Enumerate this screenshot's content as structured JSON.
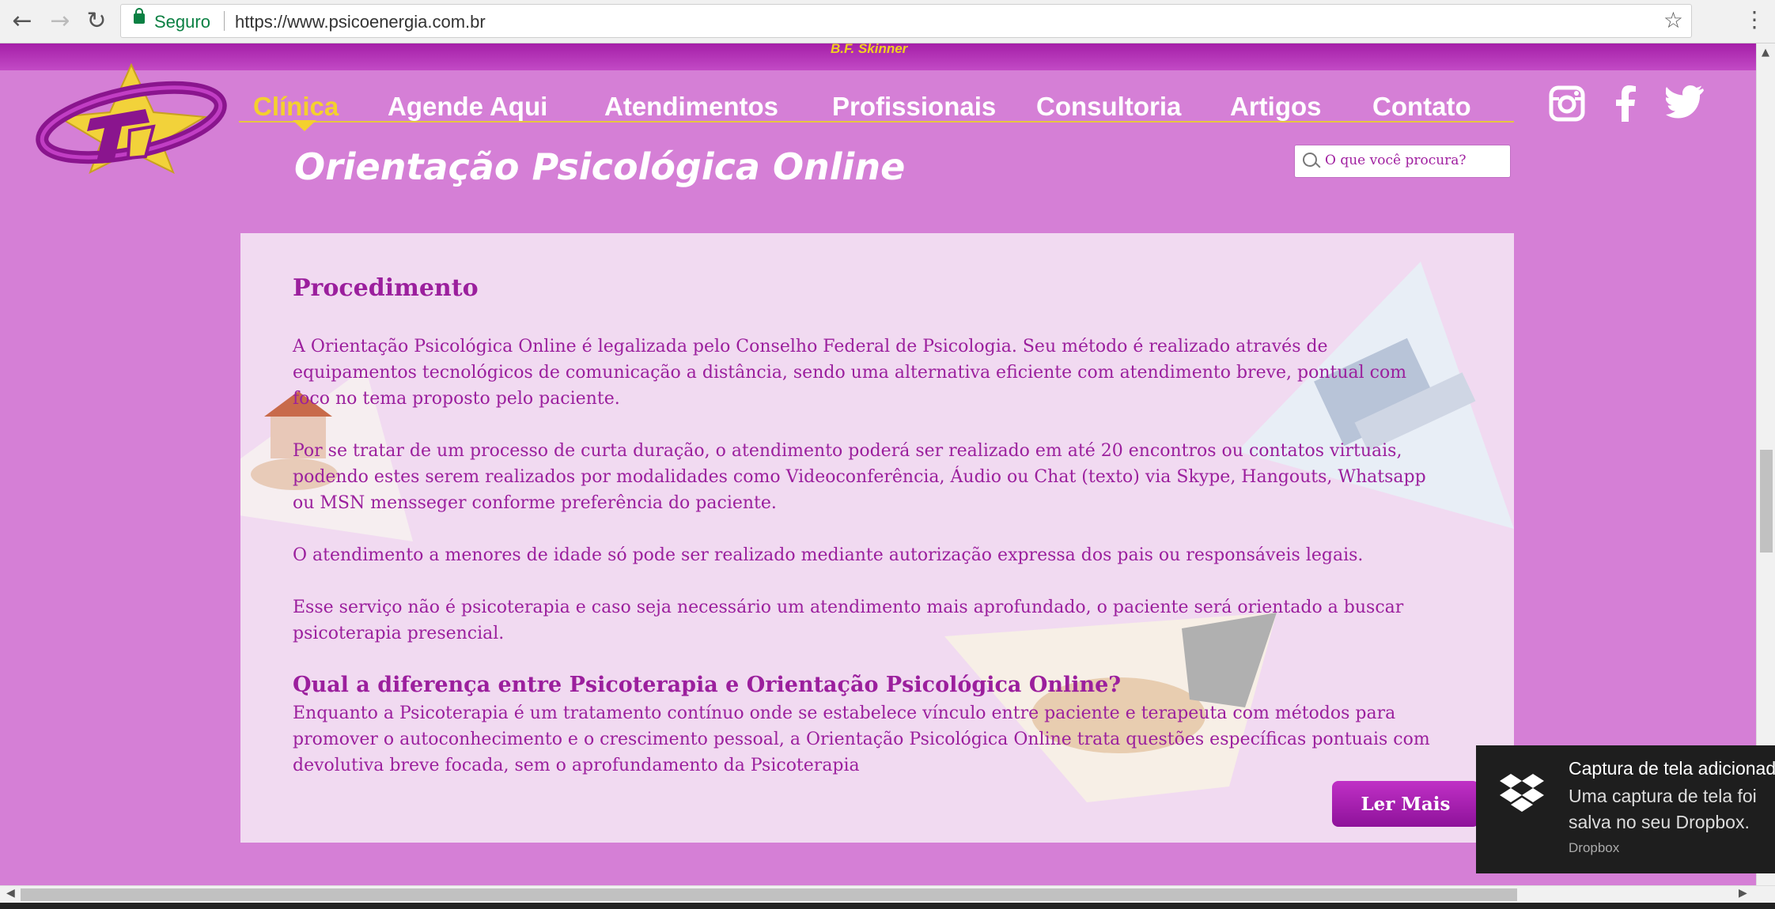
{
  "browser": {
    "back_icon": "back-arrow-icon",
    "forward_icon": "forward-arrow-icon",
    "reload_icon": "reload-icon",
    "secure_label": "Seguro",
    "url": "https://www.psicoenergia.com.br",
    "bookmark_icon": "star-icon",
    "menu_icon": "vertical-dots-icon"
  },
  "header": {
    "top_text": "B.F. Skinner",
    "logo_alt": "logo",
    "nav": [
      "Clínica",
      "Agende Aqui",
      "Atendimentos",
      "Profissionais",
      "Consultoria",
      "Artigos",
      "Contato"
    ],
    "active_nav": "Clínica",
    "social": [
      "instagram-icon",
      "facebook-icon",
      "twitter-icon"
    ],
    "page_title": "Orientação Psicológica Online",
    "search_placeholder": "O que você procura?"
  },
  "content": {
    "heading1": "Procedimento",
    "p1": "A Orientação Psicológica Online é legalizada pelo Conselho Federal de Psicologia. Seu método é realizado através de equipamentos tecnológicos de comunicação a distância, sendo uma alternativa eficiente com atendimento breve, pontual com foco no tema proposto pelo paciente.",
    "p2": "Por se tratar de um processo de curta duração, o atendimento poderá ser realizado em até 20 encontros ou contatos virtuais, podendo estes serem realizados por modalidades como Videoconferência, Áudio ou Chat (texto) via Skype, Hangouts, Whatsapp ou MSN mensseger conforme preferência do paciente.",
    "p3": "O atendimento a menores de idade só pode ser realizado mediante autorização expressa dos pais ou responsáveis legais.",
    "p4": "Esse serviço não é psicoterapia e caso seja necessário um atendimento mais aprofundado, o paciente será orientado a buscar psicoterapia presencial.",
    "heading2": "Qual a diferença entre Psicoterapia e Orientação Psicológica Online?",
    "p5": "Enquanto a Psicoterapia é um tratamento contínuo onde se estabelece vínculo entre paciente e terapeuta com métodos para promover o autoconhecimento e o crescimento pessoal, a Orientação Psicológica Online trata questões específicas pontuais com devolutiva breve focada, sem o aprofundamento da Psicoterapia",
    "read_more": "Ler Mais"
  },
  "toast": {
    "title": "Captura de tela adicionada",
    "message": "Uma captura de tela foi salva no seu Dropbox.",
    "app": "Dropbox",
    "icon": "dropbox-icon"
  },
  "colors": {
    "background": "#d57fd6",
    "accent": "#9b1f9d",
    "nav_active": "#f4d02e",
    "panel": "#f1daf1"
  }
}
